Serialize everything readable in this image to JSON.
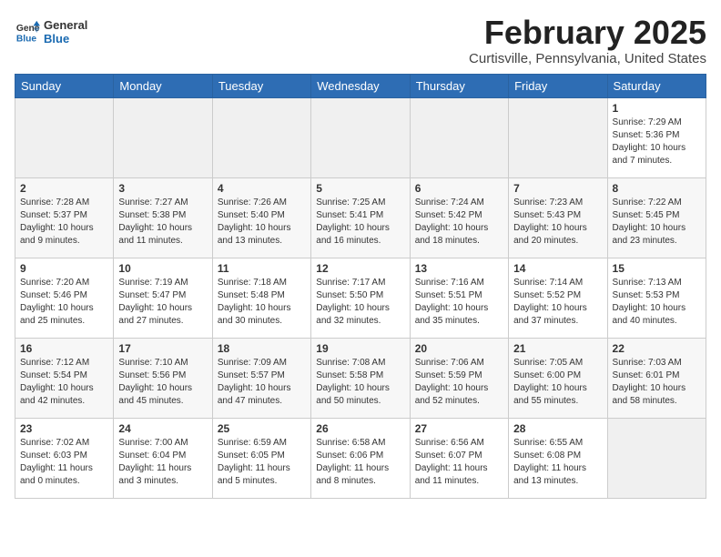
{
  "header": {
    "logo_line1": "General",
    "logo_line2": "Blue",
    "month_title": "February 2025",
    "location": "Curtisville, Pennsylvania, United States"
  },
  "weekdays": [
    "Sunday",
    "Monday",
    "Tuesday",
    "Wednesday",
    "Thursday",
    "Friday",
    "Saturday"
  ],
  "weeks": [
    [
      {
        "day": "",
        "info": ""
      },
      {
        "day": "",
        "info": ""
      },
      {
        "day": "",
        "info": ""
      },
      {
        "day": "",
        "info": ""
      },
      {
        "day": "",
        "info": ""
      },
      {
        "day": "",
        "info": ""
      },
      {
        "day": "1",
        "info": "Sunrise: 7:29 AM\nSunset: 5:36 PM\nDaylight: 10 hours and 7 minutes."
      }
    ],
    [
      {
        "day": "2",
        "info": "Sunrise: 7:28 AM\nSunset: 5:37 PM\nDaylight: 10 hours and 9 minutes."
      },
      {
        "day": "3",
        "info": "Sunrise: 7:27 AM\nSunset: 5:38 PM\nDaylight: 10 hours and 11 minutes."
      },
      {
        "day": "4",
        "info": "Sunrise: 7:26 AM\nSunset: 5:40 PM\nDaylight: 10 hours and 13 minutes."
      },
      {
        "day": "5",
        "info": "Sunrise: 7:25 AM\nSunset: 5:41 PM\nDaylight: 10 hours and 16 minutes."
      },
      {
        "day": "6",
        "info": "Sunrise: 7:24 AM\nSunset: 5:42 PM\nDaylight: 10 hours and 18 minutes."
      },
      {
        "day": "7",
        "info": "Sunrise: 7:23 AM\nSunset: 5:43 PM\nDaylight: 10 hours and 20 minutes."
      },
      {
        "day": "8",
        "info": "Sunrise: 7:22 AM\nSunset: 5:45 PM\nDaylight: 10 hours and 23 minutes."
      }
    ],
    [
      {
        "day": "9",
        "info": "Sunrise: 7:20 AM\nSunset: 5:46 PM\nDaylight: 10 hours and 25 minutes."
      },
      {
        "day": "10",
        "info": "Sunrise: 7:19 AM\nSunset: 5:47 PM\nDaylight: 10 hours and 27 minutes."
      },
      {
        "day": "11",
        "info": "Sunrise: 7:18 AM\nSunset: 5:48 PM\nDaylight: 10 hours and 30 minutes."
      },
      {
        "day": "12",
        "info": "Sunrise: 7:17 AM\nSunset: 5:50 PM\nDaylight: 10 hours and 32 minutes."
      },
      {
        "day": "13",
        "info": "Sunrise: 7:16 AM\nSunset: 5:51 PM\nDaylight: 10 hours and 35 minutes."
      },
      {
        "day": "14",
        "info": "Sunrise: 7:14 AM\nSunset: 5:52 PM\nDaylight: 10 hours and 37 minutes."
      },
      {
        "day": "15",
        "info": "Sunrise: 7:13 AM\nSunset: 5:53 PM\nDaylight: 10 hours and 40 minutes."
      }
    ],
    [
      {
        "day": "16",
        "info": "Sunrise: 7:12 AM\nSunset: 5:54 PM\nDaylight: 10 hours and 42 minutes."
      },
      {
        "day": "17",
        "info": "Sunrise: 7:10 AM\nSunset: 5:56 PM\nDaylight: 10 hours and 45 minutes."
      },
      {
        "day": "18",
        "info": "Sunrise: 7:09 AM\nSunset: 5:57 PM\nDaylight: 10 hours and 47 minutes."
      },
      {
        "day": "19",
        "info": "Sunrise: 7:08 AM\nSunset: 5:58 PM\nDaylight: 10 hours and 50 minutes."
      },
      {
        "day": "20",
        "info": "Sunrise: 7:06 AM\nSunset: 5:59 PM\nDaylight: 10 hours and 52 minutes."
      },
      {
        "day": "21",
        "info": "Sunrise: 7:05 AM\nSunset: 6:00 PM\nDaylight: 10 hours and 55 minutes."
      },
      {
        "day": "22",
        "info": "Sunrise: 7:03 AM\nSunset: 6:01 PM\nDaylight: 10 hours and 58 minutes."
      }
    ],
    [
      {
        "day": "23",
        "info": "Sunrise: 7:02 AM\nSunset: 6:03 PM\nDaylight: 11 hours and 0 minutes."
      },
      {
        "day": "24",
        "info": "Sunrise: 7:00 AM\nSunset: 6:04 PM\nDaylight: 11 hours and 3 minutes."
      },
      {
        "day": "25",
        "info": "Sunrise: 6:59 AM\nSunset: 6:05 PM\nDaylight: 11 hours and 5 minutes."
      },
      {
        "day": "26",
        "info": "Sunrise: 6:58 AM\nSunset: 6:06 PM\nDaylight: 11 hours and 8 minutes."
      },
      {
        "day": "27",
        "info": "Sunrise: 6:56 AM\nSunset: 6:07 PM\nDaylight: 11 hours and 11 minutes."
      },
      {
        "day": "28",
        "info": "Sunrise: 6:55 AM\nSunset: 6:08 PM\nDaylight: 11 hours and 13 minutes."
      },
      {
        "day": "",
        "info": ""
      }
    ]
  ]
}
